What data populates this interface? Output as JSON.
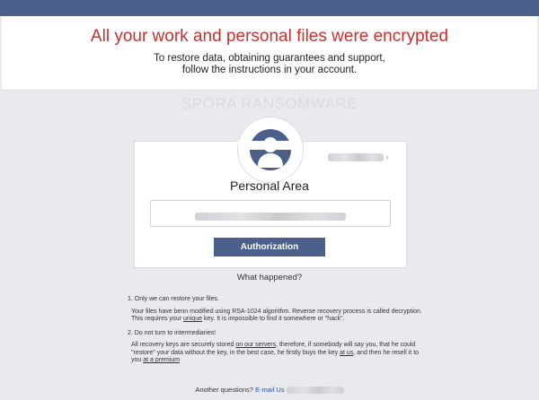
{
  "header": {
    "title": "All your work and personal files were encrypted",
    "subtitle_line1": "To restore data, obtaining guarantees and support,",
    "subtitle_line2": "follow the instructions in your account."
  },
  "watermark": "SPORA RANSOMWARE",
  "card": {
    "avatar_icon": "user-icon",
    "title": "Personal Area",
    "auth_button": "Authorization"
  },
  "what_happened": "What happened?",
  "info": {
    "item1_heading": "1. Only we can restore your files.",
    "item1_text_a": "Your files have benn modified using RSA-1024 algorithm. Reverse recovery process is called decryption. This requires your ",
    "item1_unique": "unique",
    "item1_text_b": " key. It is impossible to find it somewhere or \"hack\".",
    "item2_heading": "2. Do not turn to intermediaries!",
    "item2_text_a": "All recovery keys are securely stored ",
    "item2_on_servers": "on our servers",
    "item2_text_b": ", therefore, if somebody will say you, that he could \"restore\" your data without the key, in the best case, he firstly buys the key ",
    "item2_at_us": "at us",
    "item2_text_c": ", and then he resell it to you ",
    "item2_premium": "at a premium"
  },
  "footer": {
    "question": "Another questions?",
    "email_label": "E-mail Us"
  },
  "colors": {
    "accent": "#4a5f8a",
    "title_red": "#c9312f",
    "background": "#e9eaed"
  }
}
